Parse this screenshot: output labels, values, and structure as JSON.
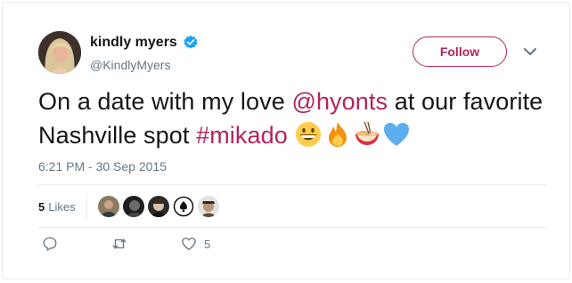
{
  "user": {
    "display_name": "kindly myers",
    "handle": "@KindlyMyers",
    "avatar_icon": "profile-photo",
    "verified_icon": "verified-badge-icon"
  },
  "follow_label": "Follow",
  "tweet": {
    "text_part1": "On a date with my love ",
    "mention": "@hyonts",
    "text_part2": " at our favorite Nashville spot ",
    "hashtag": "#mikado",
    "emojis": [
      "grinning-face-emoji",
      "fire-emoji",
      "ramen-bowl-emoji",
      "blue-heart-emoji"
    ]
  },
  "timestamp": "6:21 PM - 30 Sep 2015",
  "stats": {
    "likes_count": "5",
    "likes_label": "Likes",
    "liker_avatars": [
      "liker-1",
      "liker-2",
      "liker-3",
      "liker-4",
      "liker-5"
    ]
  },
  "actions": {
    "reply_icon": "reply-icon",
    "retweet_icon": "retweet-icon",
    "like_icon": "heart-icon",
    "like_count": "5"
  },
  "colors": {
    "accent": "#b3245e",
    "secondary_text": "#657786",
    "verified": "#1da1f2",
    "border": "#e6ecf0"
  }
}
